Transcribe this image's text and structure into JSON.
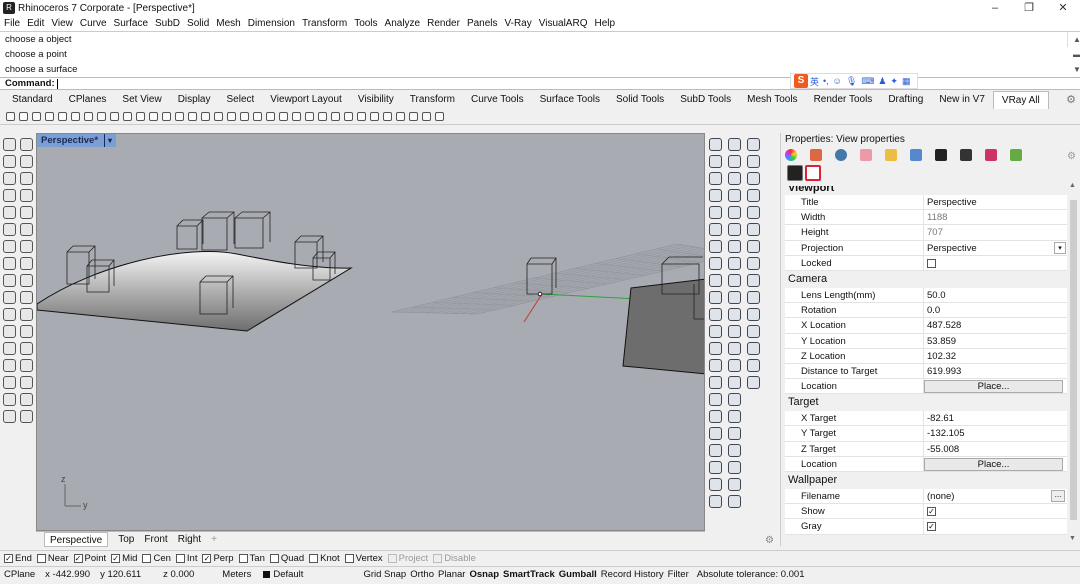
{
  "window": {
    "title": "Rhinoceros 7 Corporate - [Perspective*]",
    "controls": [
      "–",
      "❐",
      "✕"
    ]
  },
  "menu": [
    "File",
    "Edit",
    "View",
    "Curve",
    "Surface",
    "SubD",
    "Solid",
    "Mesh",
    "Dimension",
    "Transform",
    "Tools",
    "Analyze",
    "Render",
    "Panels",
    "V-Ray",
    "VisualARQ",
    "Help"
  ],
  "command_history": [
    "choose a object",
    "choose a point",
    "choose a surface"
  ],
  "command_prompt": "Command:",
  "ime_bar": {
    "badge": "S",
    "lang": "英"
  },
  "toolbar_tabs": {
    "items": [
      "Standard",
      "CPlanes",
      "Set View",
      "Display",
      "Select",
      "Viewport Layout",
      "Visibility",
      "Transform",
      "Curve Tools",
      "Surface Tools",
      "Solid Tools",
      "SubD Tools",
      "Mesh Tools",
      "Render Tools",
      "Drafting",
      "New in V7",
      "VRay All"
    ],
    "active": "VRay All"
  },
  "viewport": {
    "name": "Perspective*",
    "dropdown": "▾",
    "axis_z": "z",
    "axis_y": "y"
  },
  "viewport_tabs": [
    "Perspective",
    "Top",
    "Front",
    "Right"
  ],
  "viewport_tabs_add": "+",
  "properties": {
    "title": "Properties: View properties",
    "cut_header": "Viewport",
    "viewport_rows": [
      {
        "label": "Title",
        "value": "Perspective",
        "dim": false
      },
      {
        "label": "Width",
        "value": "1188",
        "dim": true
      },
      {
        "label": "Height",
        "value": "707",
        "dim": true
      },
      {
        "label": "Projection",
        "value": "Perspective",
        "dim": false,
        "dropdown": true
      },
      {
        "label": "Locked",
        "value": "",
        "checkbox": true,
        "checked": false
      }
    ],
    "camera_title": "Camera",
    "camera_rows": [
      {
        "label": "Lens Length(mm)",
        "value": "50.0"
      },
      {
        "label": "Rotation",
        "value": "0.0"
      },
      {
        "label": "X Location",
        "value": "487.528"
      },
      {
        "label": "Y Location",
        "value": "53.859"
      },
      {
        "label": "Z Location",
        "value": "102.32"
      },
      {
        "label": "Distance to Target",
        "value": "619.993"
      },
      {
        "label": "Location",
        "button": "Place..."
      }
    ],
    "target_title": "Target",
    "target_rows": [
      {
        "label": "X Target",
        "value": "-82.61"
      },
      {
        "label": "Y Target",
        "value": "-132.105"
      },
      {
        "label": "Z Target",
        "value": "-55.008"
      },
      {
        "label": "Location",
        "button": "Place..."
      }
    ],
    "wallpaper_title": "Wallpaper",
    "wallpaper_rows": [
      {
        "label": "Filename",
        "value": "(none)",
        "dots": "..."
      },
      {
        "label": "Show",
        "checkbox": true,
        "checked": true
      },
      {
        "label": "Gray",
        "checkbox": true,
        "checked": true
      }
    ]
  },
  "osnaps": [
    {
      "label": "End",
      "checked": true
    },
    {
      "label": "Near",
      "checked": false
    },
    {
      "label": "Point",
      "checked": true
    },
    {
      "label": "Mid",
      "checked": true
    },
    {
      "label": "Cen",
      "checked": false
    },
    {
      "label": "Int",
      "checked": false
    },
    {
      "label": "Perp",
      "checked": true
    },
    {
      "label": "Tan",
      "checked": false
    },
    {
      "label": "Quad",
      "checked": false
    },
    {
      "label": "Knot",
      "checked": false
    },
    {
      "label": "Vertex",
      "checked": false
    },
    {
      "label": "Project",
      "checked": false,
      "disabled": true
    },
    {
      "label": "Disable",
      "checked": false,
      "disabled": true
    }
  ],
  "status": {
    "cplane": "CPlane",
    "x": "x -442.990",
    "y": "y 120.611",
    "z": "z 0.000",
    "units": "Meters",
    "layer": "Default",
    "toggles": [
      {
        "label": "Grid Snap",
        "bold": false
      },
      {
        "label": "Ortho",
        "bold": false
      },
      {
        "label": "Planar",
        "bold": false
      },
      {
        "label": "Osnap",
        "bold": true
      },
      {
        "label": "SmartTrack",
        "bold": true
      },
      {
        "label": "Gumball",
        "bold": true
      },
      {
        "label": "Record History",
        "bold": false
      },
      {
        "label": "Filter",
        "bold": false
      }
    ],
    "tolerance": "Absolute tolerance: 0.001"
  },
  "colors": {
    "viewport_bg": "#a8acb2",
    "viewport_tab": "#7a9fd6",
    "x_axis": "#c0392b",
    "y_axis": "#2ea043"
  }
}
